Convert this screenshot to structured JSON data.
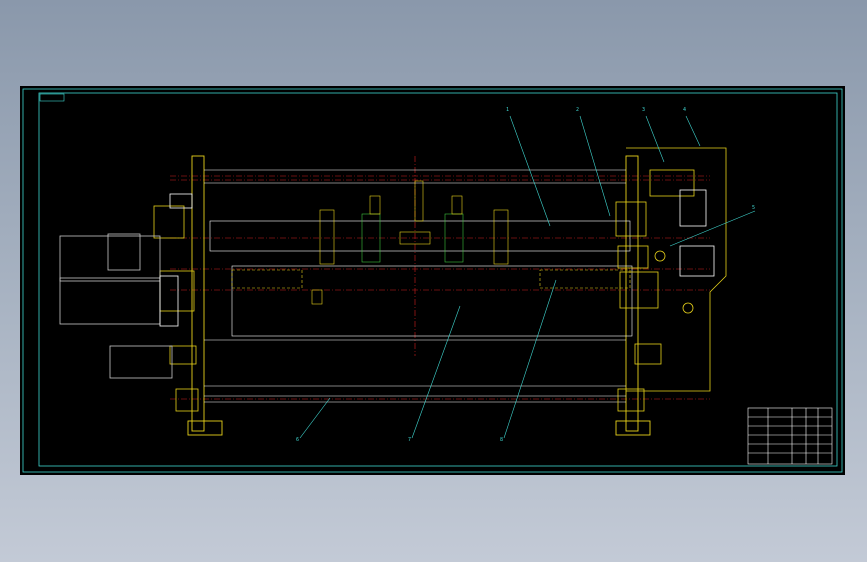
{
  "colors": {
    "background": "#000000",
    "frame": "#3fd6d0",
    "outline": "#ffffff",
    "part": "#e8d21a",
    "centerline": "#d21f1f",
    "leader": "#3fd6d0",
    "green_part": "#3ec43e",
    "grey_motor": "#c9c9c9"
  },
  "drawing": {
    "sheet_label": "",
    "balloons": [
      "1",
      "2",
      "3",
      "4",
      "5",
      "6",
      "7",
      "8"
    ],
    "left_annotation": "",
    "right_annotation": "",
    "title_block": {
      "rows": 6,
      "cols": 6
    }
  }
}
